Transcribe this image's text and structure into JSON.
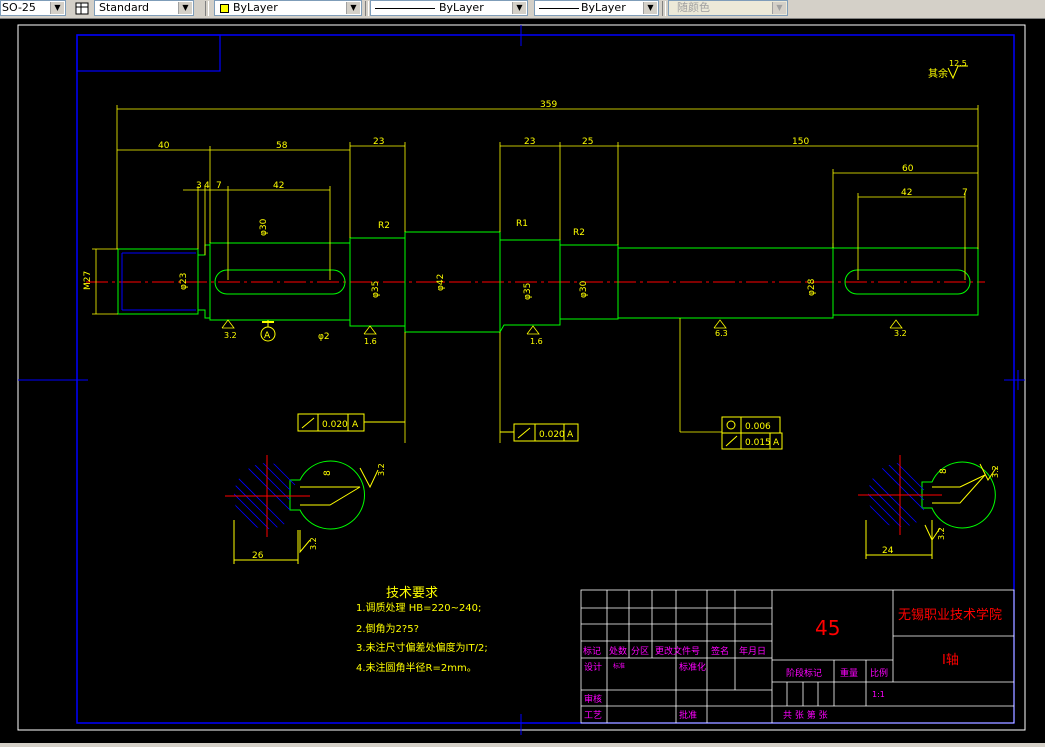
{
  "toolbar": {
    "dimstyle_value": "SO-25",
    "tablestyle_value": "Standard",
    "layer_color_value": "ByLayer",
    "linetype_value": "ByLayer",
    "lineweight_value": "ByLayer",
    "plotstyle_value": "随颜色",
    "layer_color_swatch": "#ffff00"
  },
  "drawing": {
    "colors": {
      "green": "#00ff00",
      "yellow": "#ffff00",
      "red": "#ff0000",
      "blue": "#0000ff",
      "magenta": "#ff00ff",
      "white": "#ffffff",
      "cyan": "#00ffff"
    },
    "roughness_other_label": "其余",
    "roughness_other_value": "12.5",
    "dims": {
      "overall": "359",
      "d40": "40",
      "d58": "58",
      "d23a": "23",
      "d23b": "23",
      "d25": "25",
      "d150": "150",
      "d60": "60",
      "d42a": "42",
      "d42b": "42",
      "d7a": "7",
      "d7b": "7",
      "d3": "3",
      "d4": "4",
      "r2a": "R2",
      "r1": "R1",
      "r2b": "R2",
      "m27": "M27",
      "dia23": "φ23",
      "dia30a": "φ30",
      "dia35a": "φ35",
      "dia42": "φ42",
      "dia35b": "φ35",
      "dia30b": "φ30",
      "dia28": "φ28",
      "phi2": "φ2",
      "rough32a": "3.2",
      "rough16a": "1.6",
      "rough16b": "1.6",
      "rough63": "6.3",
      "rough32b": "3.2",
      "datum_a": "A",
      "sec_left_8": "8",
      "sec_left_26": "26",
      "sec_left_rough_top": "3.2",
      "sec_left_rough_bot": "3.2",
      "sec_right_8": "8",
      "sec_right_24": "24",
      "sec_right_rough_top": "3.2",
      "sec_right_rough_bot": "3.2"
    },
    "tolerances": {
      "runout_left": "0.020",
      "runout_left_datum": "A",
      "runout_mid": "0.020",
      "runout_mid_datum": "A",
      "cyl": "0.006",
      "runout_right": "0.015",
      "runout_right_datum": "A"
    },
    "tech_requirements": {
      "title": "技术要求",
      "items": [
        "1.调质处理 HB=220~240;",
        "2.倒角为2?5?",
        "3.未注尺寸偏差处偏度为IT/2;",
        "4.未注圆角半径R=2mm。"
      ]
    },
    "title_block": {
      "material": "45",
      "school": "无锡职业技术学院",
      "part_name": "I轴",
      "headers": [
        "标记",
        "处数",
        "分区",
        "更改文件号",
        "签名",
        "年月日"
      ],
      "design": "设计",
      "design_sig": "标准",
      "standardize": "标准化",
      "stage_mark": "阶段标记",
      "weight": "重量",
      "scale": "比例",
      "scale_value": "1:1",
      "audit": "审核",
      "process": "工艺",
      "approve": "批准",
      "sheets": "共  张  第  张"
    }
  }
}
